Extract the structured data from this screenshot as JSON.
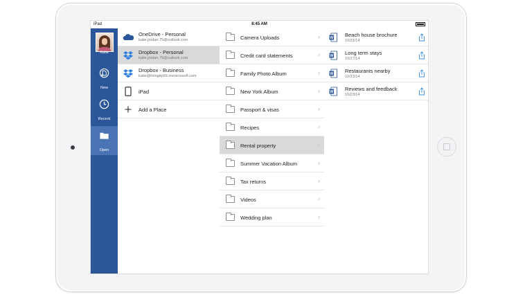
{
  "status_bar": {
    "carrier": "iPad",
    "time": "8:45 AM"
  },
  "rail": {
    "items": [
      {
        "label": "Katie",
        "icon": "avatar"
      },
      {
        "label": "New",
        "icon": "new-document-icon"
      },
      {
        "label": "Recent",
        "icon": "clock-icon"
      },
      {
        "label": "Open",
        "icon": "folder-open-icon"
      }
    ]
  },
  "places": [
    {
      "title": "OneDrive - Personal",
      "subtitle": "katie.jordan.75@outlook.com",
      "icon": "onedrive-cloud-icon"
    },
    {
      "title": "Dropbox - Personal",
      "subtitle": "katie.jordan.75@outlook.com",
      "icon": "dropbox-icon"
    },
    {
      "title": "Dropbox - Business",
      "subtitle": "katie@livingtip99.onmicrosoft.com",
      "icon": "dropbox-icon"
    },
    {
      "title": "iPad",
      "icon": "ipad-icon"
    },
    {
      "title": "Add a Place",
      "icon": "plus-icon"
    }
  ],
  "folders": [
    "Camera Uploads",
    "Credit card statements",
    "Family Photo Album",
    "New York Album",
    "Passport & visas",
    "Recipes",
    "Rental property",
    "Summer Vacation Album",
    "Tax returns",
    "Videos",
    "Wedding plan"
  ],
  "documents": [
    {
      "title": "Beach house brochure",
      "date": "10/31/14"
    },
    {
      "title": "Long term stays",
      "date": "10/27/14"
    },
    {
      "title": "Restaurants nearby",
      "date": "10/23/14"
    },
    {
      "title": "Reviews and feedback",
      "date": "10/23/14"
    }
  ],
  "colors": {
    "accent": "#2b579a",
    "rail_active": "#4b74b5",
    "selection": "#d9d9db",
    "dropbox": "#2e7fdd",
    "share": "#3c8de0"
  }
}
